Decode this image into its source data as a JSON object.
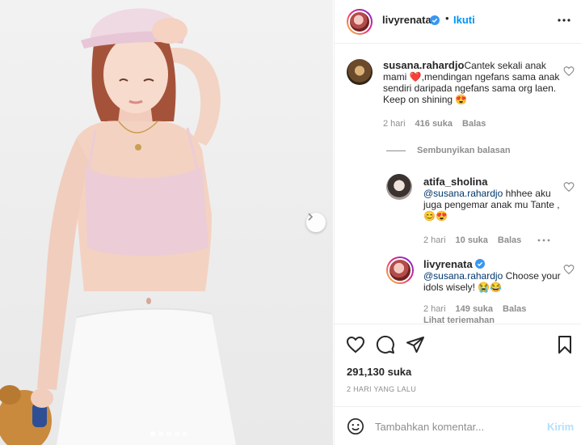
{
  "post": {
    "author": "livyrenata",
    "follow_label": "Ikuti",
    "separator": "•",
    "likes": "291,130 suka",
    "date": "2 HARI YANG LALU",
    "image_count": 5,
    "active_image": 1
  },
  "comments": [
    {
      "username": "susana.rahardjo",
      "text": "Cantek sekali anak mami ❤️,mendingan ngefans sama anak sendiri daripada ngefans sama org laen. Keep on shining 😍",
      "time": "2 hari",
      "likes": "416 suka",
      "reply_label": "Balas"
    }
  ],
  "hide_replies_label": "Sembunyikan balasan",
  "replies": [
    {
      "username": "atifa_sholina",
      "mention": "@susana.rahardjo",
      "text": " hhhee aku juga pengemar anak mu Tante , 😊😍",
      "time": "2 hari",
      "likes": "10 suka",
      "reply_label": "Balas"
    },
    {
      "username": "livyrenata",
      "mention": "@susana.rahardjo",
      "text": " Choose your idols wisely! 😭😂",
      "time": "2 hari",
      "likes": "149 suka",
      "reply_label": "Balas"
    }
  ],
  "cut_off_text": "Lihat terjemahan",
  "add_comment": {
    "placeholder": "Tambahkan komentar...",
    "post_label": "Kirim"
  },
  "icons": {
    "more": "more-horizontal-icon",
    "next": "chevron-right-icon",
    "like": "heart-icon",
    "comment": "comment-bubble-icon",
    "share": "paper-plane-icon",
    "save": "bookmark-icon",
    "emoji": "smiley-icon",
    "verified": "verified-badge-icon"
  },
  "colors": {
    "accent": "#0095f6",
    "mention": "#00376b",
    "muted": "#8e8e8e",
    "border": "#efefef",
    "verified": "#3897f0",
    "post_disabled": "#b2dffc"
  }
}
